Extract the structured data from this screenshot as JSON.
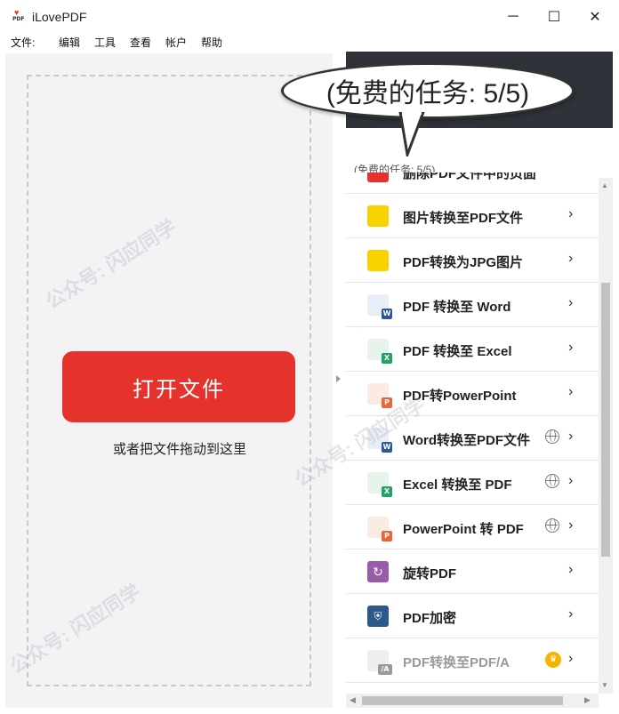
{
  "window": {
    "title": "iLovePDF",
    "app_icon_pdf": "PDF"
  },
  "window_controls": {
    "minimize": "─",
    "maximize": "☐",
    "close": "✕"
  },
  "menu": [
    {
      "label": "文件:"
    },
    {
      "label": "编辑"
    },
    {
      "label": "工具"
    },
    {
      "label": "查看"
    },
    {
      "label": "帐户"
    },
    {
      "label": "帮助"
    }
  ],
  "left": {
    "open_button": "打开文件",
    "drag_hint": "或者把文件拖动到这里"
  },
  "right": {
    "free_tasks_small": "(免费的任务: 5/5)",
    "callout": "(免费的任务: 5/5)",
    "tools": [
      {
        "label": "删除PDF文件中的页面",
        "icon": "delete-pages-icon",
        "color": "#e5322d",
        "badge": "",
        "extra": ""
      },
      {
        "label": "图片转换至PDF文件",
        "icon": "image-to-pdf-icon",
        "color": "#f7d100",
        "badge": "",
        "extra": ""
      },
      {
        "label": "PDF转换为JPG图片",
        "icon": "pdf-to-jpg-icon",
        "color": "#f7d100",
        "badge": "",
        "extra": ""
      },
      {
        "label": "PDF 转换至 Word",
        "icon": "pdf-to-word-icon",
        "color": "#2b579a",
        "badge": "W",
        "extra": ""
      },
      {
        "label": "PDF 转换至 Excel",
        "icon": "pdf-to-excel-icon",
        "color": "#21a366",
        "badge": "X",
        "extra": ""
      },
      {
        "label": "PDF转PowerPoint",
        "icon": "pdf-to-ppt-icon",
        "color": "#e8663b",
        "badge": "P",
        "extra": ""
      },
      {
        "label": "Word转换至PDF文件",
        "icon": "word-to-pdf-icon",
        "color": "#2b579a",
        "badge": "W",
        "extra": "globe-icon"
      },
      {
        "label": "Excel 转换至 PDF",
        "icon": "excel-to-pdf-icon",
        "color": "#21a366",
        "badge": "X",
        "extra": "globe-icon"
      },
      {
        "label": "PowerPoint 转 PDF",
        "icon": "ppt-to-pdf-icon",
        "color": "#e8663b",
        "badge": "P",
        "extra": "globe-icon"
      },
      {
        "label": "旋转PDF",
        "icon": "rotate-pdf-icon",
        "color": "#9a5ba8",
        "badge": "",
        "extra": ""
      },
      {
        "label": "PDF加密",
        "icon": "protect-pdf-icon",
        "color": "#2b5a8a",
        "badge": "",
        "extra": ""
      },
      {
        "label": "PDF转换至PDF/A",
        "icon": "pdf-to-pdfa-icon",
        "color": "#9a9a9a",
        "badge": "/A",
        "extra": "crown-icon",
        "disabled": true
      }
    ],
    "chevron": "›"
  },
  "watermark": "公众号: 闪应同学",
  "colors": {
    "accent": "#e5322d",
    "header_dark": "#2f3238"
  }
}
